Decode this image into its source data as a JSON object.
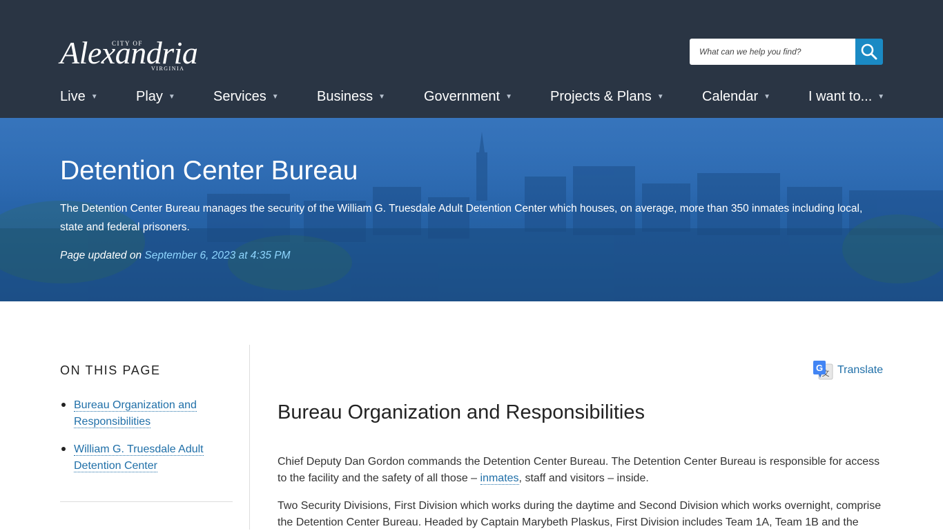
{
  "header": {
    "logo": {
      "city_of": "CITY OF",
      "name": "Alexandria",
      "state": "VIRGINIA"
    },
    "search": {
      "placeholder": "What can we help you find?"
    },
    "nav": [
      {
        "label": "Live"
      },
      {
        "label": "Play"
      },
      {
        "label": "Services"
      },
      {
        "label": "Business"
      },
      {
        "label": "Government"
      },
      {
        "label": "Projects & Plans"
      },
      {
        "label": "Calendar"
      },
      {
        "label": "I want to..."
      }
    ],
    "caret": "▼"
  },
  "hero": {
    "title": "Detention Center Bureau",
    "description": "The Detention Center Bureau manages the security of the William G. Truesdale Adult Detention Center which houses, on average, more than 350 inmates including local, state and federal prisoners.",
    "updated_prefix": "Page updated on",
    "updated_date": "September 6, 2023 at 4:35 PM"
  },
  "sidebar": {
    "heading": "ON THIS PAGE",
    "items": [
      {
        "label": "Bureau Organization and Responsibilities"
      },
      {
        "label": "William G. Truesdale Adult Detention Center"
      }
    ]
  },
  "main": {
    "translate_label": "Translate",
    "section_title": "Bureau Organization and Responsibilities",
    "p1_before": "Chief Deputy Dan Gordon commands the Detention Center Bureau. The Detention Center Bureau is responsible for access to the facility and the safety of all those – ",
    "p1_link": "inmates",
    "p1_after": ", staff and visitors – inside.",
    "p2": "Two Security Divisions, First Division which works during the daytime and Second Division which works overnight, comprise the Detention Center Bureau. Headed by Captain Marybeth Plaskus, First Division includes Team 1A, Team 1B and the"
  },
  "colors": {
    "header_bg": "#2a3544",
    "hero_blue": "#2a67ae",
    "link": "#1f6fa8",
    "search_button": "#1a8ac4",
    "date_highlight": "#8fd6ff"
  }
}
